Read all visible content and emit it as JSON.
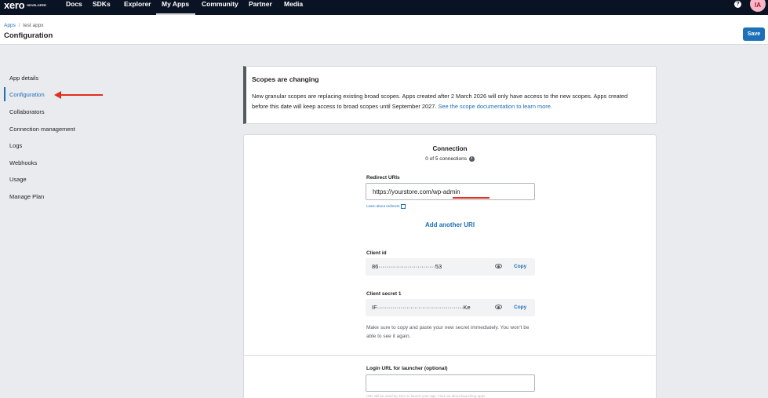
{
  "nav": {
    "logo": "xero",
    "logo_sub": "DEVELOPER",
    "items": [
      "Docs",
      "SDKs",
      "Explorer",
      "My Apps",
      "Community",
      "Partner",
      "Media"
    ],
    "help_icon": "question-icon",
    "avatar_initials": "IA"
  },
  "header": {
    "breadcrumb_root": "Apps",
    "breadcrumb_sep": "/",
    "breadcrumb_app": "test appx",
    "title": "Configuration",
    "save_label": "Save"
  },
  "sidebar": {
    "items": [
      "App details",
      "Configuration",
      "Collaborators",
      "Connection management",
      "Logs",
      "Webhooks",
      "Usage",
      "Manage Plan"
    ],
    "active": "Configuration"
  },
  "banner": {
    "title": "Scopes are changing",
    "text": "New granular scopes are replacing existing broad scopes. Apps created after 2 March 2026 will only have access to the new scopes. Apps created before this date will keep access to broad scopes until September 2027. ",
    "link": "See the scope documentation to learn more."
  },
  "connection": {
    "title": "Connection",
    "count": "0 of 5 connections",
    "redirect_label": "Redirect URIs",
    "redirect_value": "https://yourstore.com/wp-admin",
    "learn_link": "Learn about redirects",
    "add_uri": "Add another URI",
    "client_id_label": "Client id",
    "client_id_value": "86·····························53",
    "copy_label": "Copy",
    "secret_label": "Client secret 1",
    "secret_value": "IF············································Ke",
    "secret_note": "Make sure to copy and paste your new secret immediately. You won't be able to see it again.",
    "login_label": "Login URL for launcher (optional)",
    "login_value": "",
    "login_help": "URL will be used by Xero to launch your app. Find out about launching apps"
  },
  "colors": {
    "nav_bg": "#0a1324",
    "accent": "#1d70b8",
    "annotation_arrow": "#e0301e"
  }
}
